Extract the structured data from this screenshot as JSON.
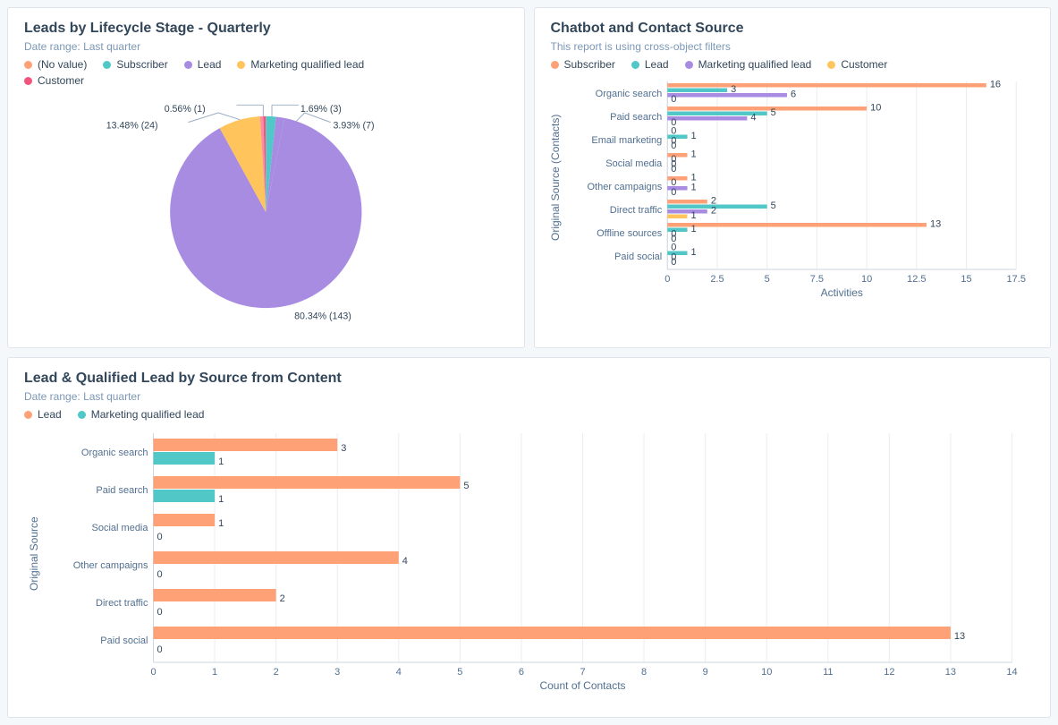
{
  "colors": {
    "subscriber": "#ffa176",
    "lead": "#52c7c7",
    "mql": "#a78ce2",
    "customer": "#ffc55c",
    "novalue": "#ff8da1",
    "customer_pink": "#f2547d"
  },
  "pie": {
    "title": "Leads by Lifecycle Stage - Quarterly",
    "date_label": "Date range:",
    "date_value": "Last quarter",
    "legend": [
      "(No value)",
      "Subscriber",
      "Lead",
      "Marketing qualified lead",
      "Customer"
    ],
    "labels": {
      "p0": "0.56% (1)",
      "p1": "1.69% (3)",
      "p2": "3.93% (7)",
      "p3": "80.34% (143)",
      "p4": "13.48% (24)"
    }
  },
  "mini": {
    "title": "Chatbot and Contact Source",
    "sub": "This report is using cross-object filters",
    "legend": [
      "Subscriber",
      "Lead",
      "Marketing qualified lead",
      "Customer"
    ],
    "ylabel": "Original Source (Contacts)",
    "xlabel": "Activities"
  },
  "big": {
    "title": "Lead & Qualified Lead by Source from Content",
    "date_label": "Date range:",
    "date_value": "Last quarter",
    "legend": [
      "Lead",
      "Marketing qualified lead"
    ],
    "ylabel": "Original Source",
    "xlabel": "Count of Contacts"
  },
  "chart_data": [
    {
      "type": "pie",
      "title": "Leads by Lifecycle Stage - Quarterly",
      "series": [
        {
          "name": "(No value)",
          "value": 1,
          "percent": 0.56,
          "color": "#ff8da1"
        },
        {
          "name": "Subscriber",
          "value": 3,
          "percent": 1.69,
          "color": "#52c7c7"
        },
        {
          "name": "Lead",
          "value": 7,
          "percent": 3.93,
          "color": "#a78ce2"
        },
        {
          "name": "Marketing qualified lead",
          "value": 24,
          "percent": 13.48,
          "color": "#ffc55c"
        },
        {
          "name": "Customer",
          "value": 143,
          "percent": 80.34,
          "color": "#a78ce2"
        }
      ]
    },
    {
      "type": "bar",
      "orientation": "horizontal",
      "title": "Chatbot and Contact Source",
      "ylabel": "Original Source (Contacts)",
      "xlabel": "Activities",
      "xlim": [
        0,
        17.5
      ],
      "xticks": [
        0,
        2.5,
        5,
        7.5,
        10,
        12.5,
        15,
        17.5
      ],
      "categories": [
        "Organic search",
        "Paid search",
        "Email marketing",
        "Social media",
        "Other campaigns",
        "Direct traffic",
        "Offline sources",
        "Paid social"
      ],
      "series": [
        {
          "name": "Subscriber",
          "color": "#ffa176",
          "values": [
            16,
            10,
            0,
            1,
            1,
            2,
            13,
            0
          ]
        },
        {
          "name": "Lead",
          "color": "#52c7c7",
          "values": [
            3,
            5,
            1,
            0,
            0,
            5,
            1,
            1
          ]
        },
        {
          "name": "Marketing qualified lead",
          "color": "#a78ce2",
          "values": [
            6,
            4,
            0,
            0,
            1,
            2,
            0,
            0
          ]
        },
        {
          "name": "Customer",
          "color": "#ffc55c",
          "values": [
            0,
            0,
            0,
            0,
            0,
            1,
            0,
            0
          ]
        }
      ]
    },
    {
      "type": "bar",
      "orientation": "horizontal",
      "title": "Lead & Qualified Lead by Source from Content",
      "ylabel": "Original Source",
      "xlabel": "Count of Contacts",
      "xlim": [
        0,
        14
      ],
      "xticks": [
        0,
        1,
        2,
        3,
        4,
        5,
        6,
        7,
        8,
        9,
        10,
        11,
        12,
        13,
        14
      ],
      "categories": [
        "Organic search",
        "Paid search",
        "Social media",
        "Other campaigns",
        "Direct traffic",
        "Paid social"
      ],
      "series": [
        {
          "name": "Lead",
          "color": "#ffa176",
          "values": [
            3,
            5,
            1,
            4,
            2,
            13
          ]
        },
        {
          "name": "Marketing qualified lead",
          "color": "#52c7c7",
          "values": [
            1,
            1,
            0,
            0,
            0,
            0
          ]
        }
      ]
    }
  ]
}
